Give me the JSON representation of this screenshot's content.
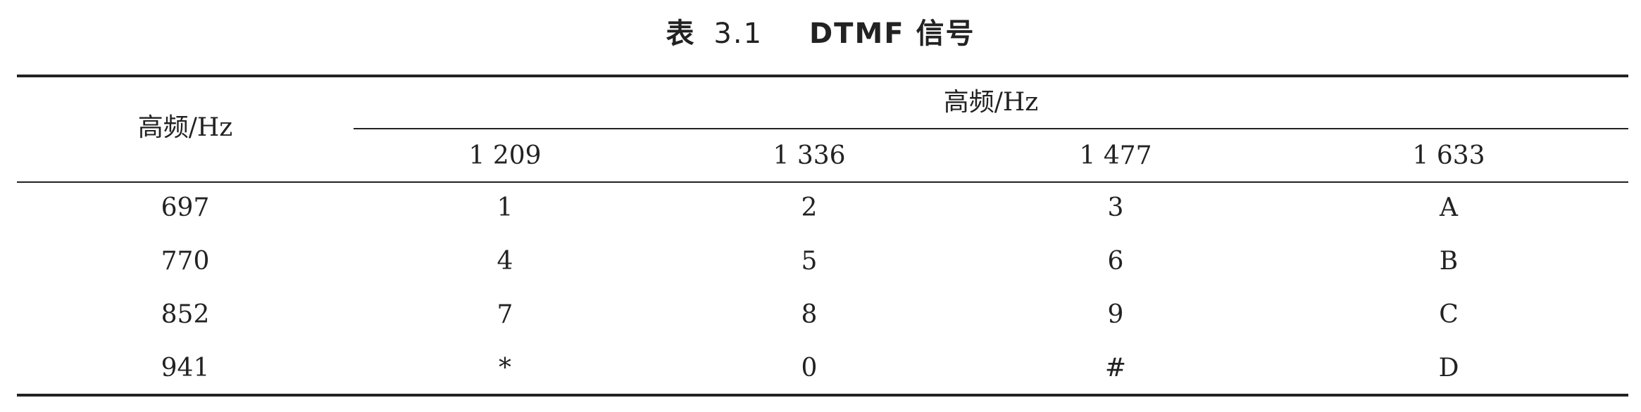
{
  "caption": {
    "prefix": "表",
    "number": "3.1",
    "title": "DTMF 信号"
  },
  "table": {
    "row_header_label": "高频/Hz",
    "column_group_label": "高频/Hz",
    "column_headers": [
      "1 209",
      "1 336",
      "1 477",
      "1 633"
    ],
    "rows": [
      {
        "freq": "697",
        "cells": [
          "1",
          "2",
          "3",
          "A"
        ]
      },
      {
        "freq": "770",
        "cells": [
          "4",
          "5",
          "6",
          "B"
        ]
      },
      {
        "freq": "852",
        "cells": [
          "7",
          "8",
          "9",
          "C"
        ]
      },
      {
        "freq": "941",
        "cells": [
          "*",
          "0",
          "#",
          "D"
        ]
      }
    ]
  }
}
